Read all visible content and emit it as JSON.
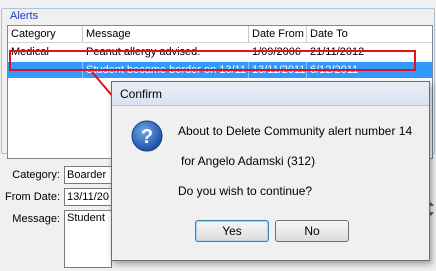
{
  "alerts": {
    "group_title": "Alerts",
    "columns": [
      "Category",
      "Message",
      "Date From",
      "Date To"
    ],
    "rows": [
      {
        "category": "Medical",
        "message": "Peanut allergy advised.",
        "date_from": "1/09/2006",
        "date_to": "21/11/2012",
        "selected": false
      },
      {
        "category": "",
        "message": "Student became border on 13/11",
        "date_from": "13/11/2011",
        "date_to": "6/12/2011",
        "selected": true
      }
    ]
  },
  "details": {
    "category_label": "Category:",
    "category_value": "Boarder",
    "from_date_label": "From Date:",
    "from_date_value": "13/11/20",
    "message_label": "Message:",
    "message_value": "Student"
  },
  "dialog": {
    "title": "Confirm",
    "line1": "About to Delete Community alert number 14",
    "line2": "for Angelo Adamski (312)",
    "line3": "Do you wish to continue?",
    "yes_label": "Yes",
    "no_label": "No",
    "icon": "question-icon"
  },
  "colors": {
    "selection": "#3399ff",
    "annotation": "#e0131c",
    "group_title": "#1c3fbf"
  }
}
